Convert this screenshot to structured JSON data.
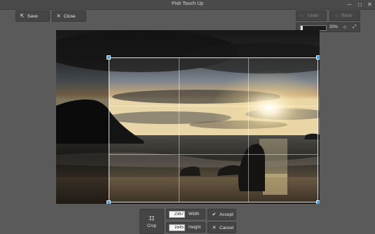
{
  "window": {
    "title": "Pixlr Touch Up",
    "minimize_glyph": "─",
    "maximize_glyph": "□",
    "close_glyph": "✕"
  },
  "toolbar": {
    "save_label": "Save",
    "close_label": "Close",
    "undo_label": "Undo",
    "redo_label": "Redo"
  },
  "icons": {
    "save": "⇱",
    "close": "✕",
    "undo": "←",
    "redo": "→",
    "crop": "⌗",
    "accept": "✔",
    "cancel": "✕",
    "fit": "⊹",
    "expand": "⤢"
  },
  "zoom": {
    "percent_label": "30%",
    "level": 0.08
  },
  "crop_panel": {
    "tool_label": "Crop",
    "width_value": "2367",
    "width_label": "Width",
    "height_value": "1645",
    "height_label": "Height",
    "accept_label": "Accept",
    "cancel_label": "Cancel"
  },
  "colors": {
    "background": "#5a5a5a",
    "panel": "#454545",
    "handle": "#4aa0e8",
    "accent": "#ffffff"
  }
}
